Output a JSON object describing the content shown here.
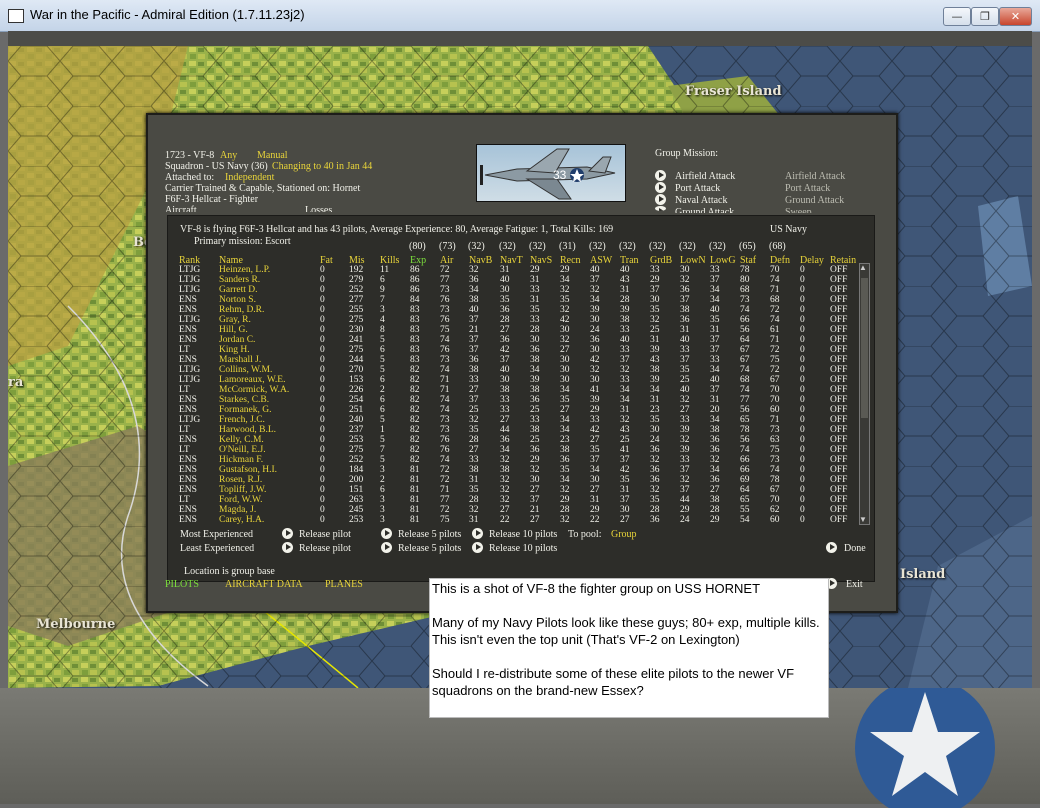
{
  "window": {
    "title": "War in the Pacific - Admiral Edition (1.7.11.23j2)",
    "min": "—",
    "max": "❐",
    "close": "✕"
  },
  "map_labels": {
    "fraser": "Fraser Island",
    "melbourne": "Melbourne",
    "island": "Island",
    "bo": "Bo",
    "ra": "ra"
  },
  "unit": {
    "id_line": "1723 - VF-8",
    "any": "Any",
    "manual": "Manual",
    "squadron": "Squadron - US Navy (36)",
    "changing": "Changing to 40 in Jan 44",
    "attached_label": "Attached to:",
    "attached_value": "Independent",
    "carrier": "Carrier Trained & Capable, Stationed on: Hornet",
    "aircraft": "F6F-3 Hellcat - Fighter",
    "aircraft_cut": "Aircraft",
    "losses_cut": "Losses"
  },
  "group_mission": {
    "label": "Group Mission:",
    "left": [
      "Airfield Attack",
      "Port Attack",
      "Naval Attack",
      "Ground Attack"
    ],
    "right": [
      "Airfield Attack",
      "Port Attack",
      "Ground Attack",
      "Sweep"
    ]
  },
  "summary": "VF-8 is flying F6F-3 Hellcat and has 43 pilots,  Average Experience: 80,  Average Fatigue: 1,  Total Kills: 169",
  "service": "US Navy",
  "primary_mission": "Primary mission: Escort",
  "averages": [
    "(80)",
    "(73)",
    "(32)",
    "(32)",
    "(32)",
    "(31)",
    "(32)",
    "(32)",
    "(32)",
    "(32)",
    "(32)",
    "(65)",
    "(68)"
  ],
  "columns": [
    "Rank",
    "Name",
    "Fat",
    "Mis",
    "Kills",
    "Exp",
    "Air",
    "NavB",
    "NavT",
    "NavS",
    "Recn",
    "ASW",
    "Tran",
    "GrdB",
    "LowN",
    "LowG",
    "Staf",
    "Defn",
    "Delay",
    "Retain"
  ],
  "pilots": [
    [
      "LTJG",
      "Heinzen, L.P.",
      "0",
      "192",
      "11",
      "86",
      "72",
      "32",
      "31",
      "29",
      "29",
      "40",
      "40",
      "33",
      "30",
      "33",
      "78",
      "70",
      "0",
      "OFF"
    ],
    [
      "LTJG",
      "Sanders R.",
      "0",
      "279",
      "6",
      "86",
      "77",
      "36",
      "40",
      "31",
      "34",
      "37",
      "43",
      "29",
      "32",
      "37",
      "80",
      "74",
      "0",
      "OFF"
    ],
    [
      "LTJG",
      "Garrett D.",
      "0",
      "252",
      "9",
      "86",
      "73",
      "34",
      "30",
      "33",
      "32",
      "32",
      "31",
      "37",
      "36",
      "34",
      "68",
      "71",
      "0",
      "OFF"
    ],
    [
      "ENS",
      "Norton S.",
      "0",
      "277",
      "7",
      "84",
      "76",
      "38",
      "35",
      "31",
      "35",
      "34",
      "28",
      "30",
      "37",
      "34",
      "73",
      "68",
      "0",
      "OFF"
    ],
    [
      "ENS",
      "Rehm, D.R.",
      "0",
      "255",
      "3",
      "83",
      "73",
      "40",
      "36",
      "35",
      "32",
      "39",
      "39",
      "35",
      "38",
      "40",
      "74",
      "72",
      "0",
      "OFF"
    ],
    [
      "LTJG",
      "Gray, R.",
      "0",
      "275",
      "4",
      "83",
      "76",
      "37",
      "28",
      "33",
      "42",
      "30",
      "38",
      "32",
      "36",
      "35",
      "66",
      "74",
      "0",
      "OFF"
    ],
    [
      "ENS",
      "Hill, G.",
      "0",
      "230",
      "8",
      "83",
      "75",
      "21",
      "27",
      "28",
      "30",
      "24",
      "33",
      "25",
      "31",
      "31",
      "56",
      "61",
      "0",
      "OFF"
    ],
    [
      "ENS",
      "Jordan C.",
      "0",
      "241",
      "5",
      "83",
      "74",
      "37",
      "36",
      "30",
      "32",
      "36",
      "40",
      "31",
      "40",
      "37",
      "64",
      "71",
      "0",
      "OFF"
    ],
    [
      "LT",
      "King H.",
      "0",
      "275",
      "6",
      "83",
      "76",
      "37",
      "42",
      "36",
      "27",
      "30",
      "33",
      "39",
      "33",
      "37",
      "67",
      "72",
      "0",
      "OFF"
    ],
    [
      "ENS",
      "Marshall J.",
      "0",
      "244",
      "5",
      "83",
      "73",
      "36",
      "37",
      "38",
      "30",
      "42",
      "37",
      "43",
      "37",
      "33",
      "67",
      "75",
      "0",
      "OFF"
    ],
    [
      "LTJG",
      "Collins, W.M.",
      "0",
      "270",
      "5",
      "82",
      "74",
      "38",
      "40",
      "34",
      "30",
      "32",
      "32",
      "38",
      "35",
      "34",
      "74",
      "72",
      "0",
      "OFF"
    ],
    [
      "LTJG",
      "Lamoreaux, W.E.",
      "0",
      "153",
      "6",
      "82",
      "71",
      "33",
      "30",
      "39",
      "30",
      "30",
      "33",
      "39",
      "25",
      "40",
      "68",
      "67",
      "0",
      "OFF"
    ],
    [
      "LT",
      "McCormick, W.A.",
      "0",
      "226",
      "2",
      "82",
      "71",
      "27",
      "38",
      "38",
      "34",
      "41",
      "34",
      "34",
      "40",
      "37",
      "74",
      "70",
      "0",
      "OFF"
    ],
    [
      "ENS",
      "Starkes, C.B.",
      "0",
      "254",
      "6",
      "82",
      "74",
      "37",
      "33",
      "36",
      "35",
      "39",
      "34",
      "31",
      "32",
      "31",
      "77",
      "70",
      "0",
      "OFF"
    ],
    [
      "ENS",
      "Formanek, G.",
      "0",
      "251",
      "6",
      "82",
      "74",
      "25",
      "33",
      "25",
      "27",
      "29",
      "31",
      "23",
      "27",
      "20",
      "56",
      "60",
      "0",
      "OFF"
    ],
    [
      "LTJG",
      "French, J.C.",
      "0",
      "240",
      "5",
      "82",
      "73",
      "32",
      "27",
      "33",
      "34",
      "33",
      "32",
      "35",
      "33",
      "34",
      "65",
      "71",
      "0",
      "OFF"
    ],
    [
      "LT",
      "Harwood, B.L.",
      "0",
      "237",
      "1",
      "82",
      "73",
      "35",
      "44",
      "38",
      "34",
      "42",
      "43",
      "30",
      "39",
      "38",
      "78",
      "73",
      "0",
      "OFF"
    ],
    [
      "ENS",
      "Kelly, C.M.",
      "0",
      "253",
      "5",
      "82",
      "76",
      "28",
      "36",
      "25",
      "23",
      "27",
      "25",
      "24",
      "32",
      "36",
      "56",
      "63",
      "0",
      "OFF"
    ],
    [
      "LT",
      "O'Neill, E.J.",
      "0",
      "275",
      "7",
      "82",
      "76",
      "27",
      "34",
      "36",
      "38",
      "35",
      "41",
      "36",
      "39",
      "36",
      "74",
      "75",
      "0",
      "OFF"
    ],
    [
      "ENS",
      "Hickman F.",
      "0",
      "252",
      "5",
      "82",
      "74",
      "33",
      "32",
      "29",
      "36",
      "37",
      "37",
      "32",
      "33",
      "32",
      "66",
      "73",
      "0",
      "OFF"
    ],
    [
      "ENS",
      "Gustafson, H.I.",
      "0",
      "184",
      "3",
      "81",
      "72",
      "38",
      "38",
      "32",
      "35",
      "34",
      "42",
      "36",
      "37",
      "34",
      "66",
      "74",
      "0",
      "OFF"
    ],
    [
      "ENS",
      "Rosen, R.J.",
      "0",
      "200",
      "2",
      "81",
      "72",
      "31",
      "32",
      "30",
      "34",
      "30",
      "35",
      "36",
      "32",
      "36",
      "69",
      "78",
      "0",
      "OFF"
    ],
    [
      "ENS",
      "Topliff, J.W.",
      "0",
      "151",
      "6",
      "81",
      "71",
      "35",
      "32",
      "27",
      "32",
      "27",
      "31",
      "32",
      "37",
      "27",
      "64",
      "67",
      "0",
      "OFF"
    ],
    [
      "LT",
      "Ford, W.W.",
      "0",
      "263",
      "3",
      "81",
      "77",
      "28",
      "32",
      "37",
      "29",
      "31",
      "37",
      "35",
      "44",
      "38",
      "65",
      "70",
      "0",
      "OFF"
    ],
    [
      "ENS",
      "Magda, J.",
      "0",
      "245",
      "3",
      "81",
      "72",
      "32",
      "27",
      "21",
      "28",
      "29",
      "30",
      "28",
      "29",
      "28",
      "55",
      "62",
      "0",
      "OFF"
    ],
    [
      "ENS",
      "Carey, H.A.",
      "0",
      "253",
      "3",
      "81",
      "75",
      "31",
      "22",
      "27",
      "32",
      "22",
      "27",
      "36",
      "24",
      "29",
      "54",
      "60",
      "0",
      "OFF"
    ]
  ],
  "controls": {
    "most": "Most Experienced",
    "least": "Least Experienced",
    "release_pilot": "Release pilot",
    "release_5": "Release 5 pilots",
    "release_10": "Release 10 pilots",
    "to_pool": "To pool:",
    "pool_value": "Group",
    "done": "Done",
    "exit": "Exit",
    "location": "Location is group base"
  },
  "tabs": [
    "PILOTS",
    "AIRCRAFT DATA",
    "PLANES"
  ],
  "note": [
    "This is a shot of VF-8 the fighter group on USS HORNET",
    "Many of my Navy Pilots look like these guys; 80+ exp, multiple kills.  This isn't even the top unit (That's VF-2 on Lexington)",
    "Should I re-distribute some of these elite pilots to the newer VF squadrons on the brand-new Essex?"
  ],
  "plane_number": "33",
  "colors": {
    "label_yellow": "#e8d43a",
    "text_white": "#f2f2ea",
    "highlight_green": "#7ce03c",
    "panel": "#4a4a44"
  }
}
